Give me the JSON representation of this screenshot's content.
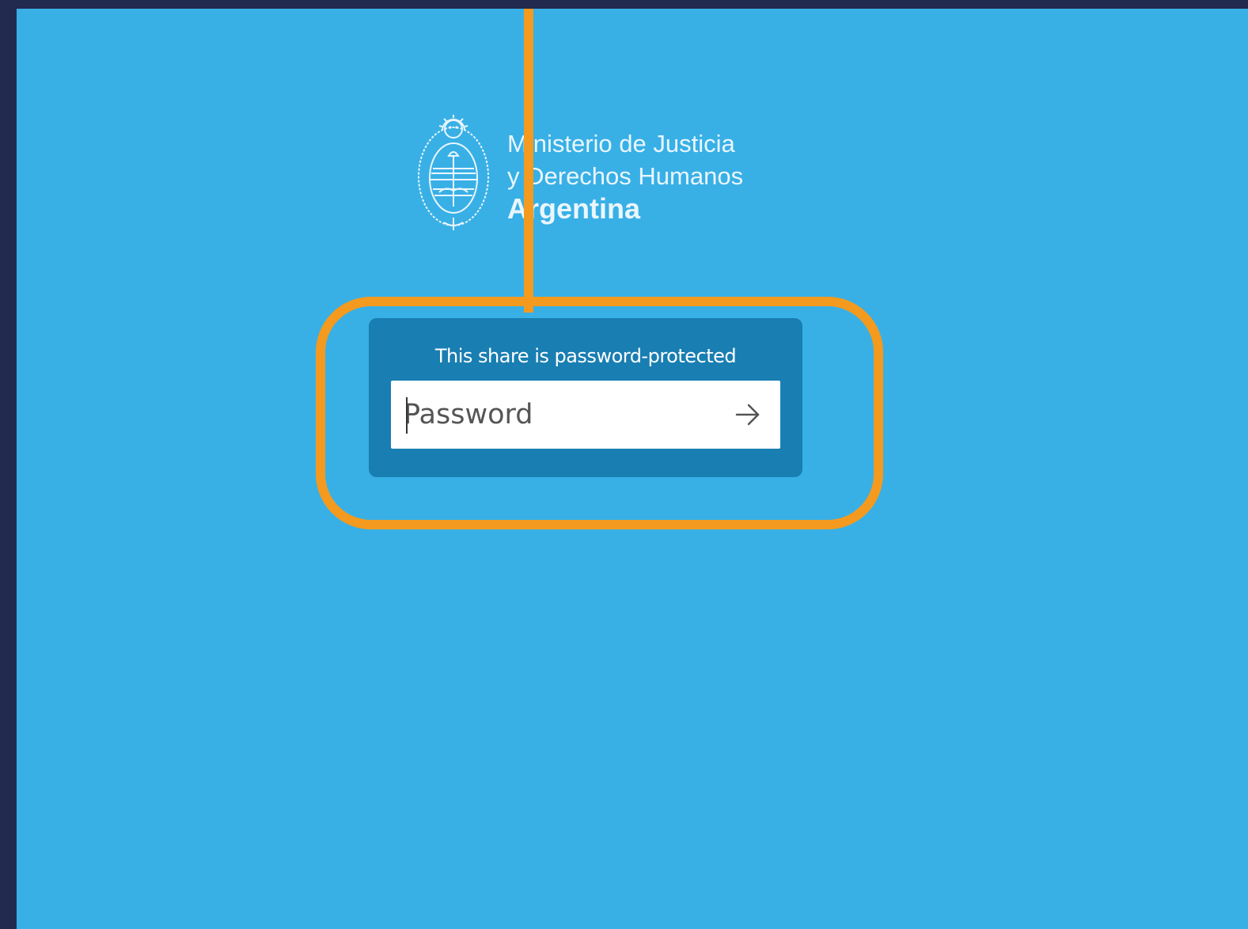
{
  "branding": {
    "line1": "Ministerio de Justicia",
    "line2": "y Derechos Humanos",
    "line3": "Argentina",
    "emblem_icon": "argentina-coat-of-arms-icon"
  },
  "share_auth": {
    "title": "This share is password-protected",
    "password_placeholder": "Password",
    "password_value": "",
    "submit_icon": "arrow-right-icon"
  },
  "colors": {
    "frame": "#232a4f",
    "background": "#38b0e6",
    "card": "#197eb2",
    "highlight": "#f39a1f",
    "input": "#ffffff"
  }
}
